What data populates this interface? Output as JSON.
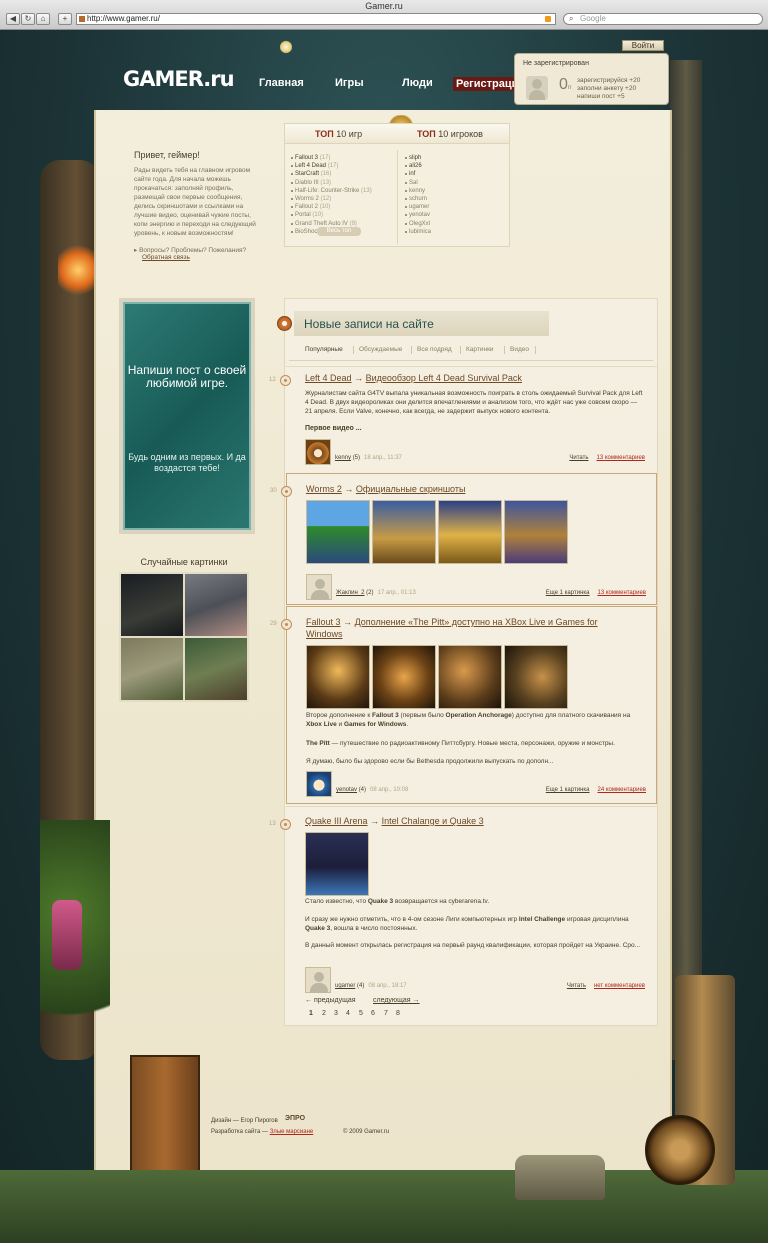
{
  "browser": {
    "window_title": "Gamer.ru",
    "url": "http://www.gamer.ru/",
    "search_placeholder": "Google"
  },
  "header": {
    "logo": "GAMER.ru",
    "nav": [
      "Главная",
      "Игры",
      "Люди",
      "Регистрация"
    ]
  },
  "login": {
    "button": "Войти",
    "status": "Не зарегистрирован",
    "points": "0",
    "points_unit": "п",
    "hints": [
      "зарегистрируйся +20",
      "заполни анкету +20",
      "напиши пост +5"
    ]
  },
  "greeting": {
    "title": "Привет, геймер!",
    "text": "Рады видеть тебя на главном игровом сайте года. Для начала можешь прокачаться: заполняй профиль, размещай свои первые сообщения, делись скриншотами и ссылками на лучшие видео, оценивай чужие посты, копи энергию и переходи на следующий уровень, к новым возможностям!",
    "questions": "Вопросы? Проблемы? Пожелания?",
    "feedback": "Обратная связь"
  },
  "top10": {
    "games_label_prefix": "ТОП",
    "games_label_num": "10",
    "games_label": "игр",
    "players_label": "игроков",
    "games": [
      {
        "name": "Fallout 3",
        "count": "(17)",
        "dim": false
      },
      {
        "name": "Left 4 Dead",
        "count": "(17)",
        "dim": false
      },
      {
        "name": "StarCraft",
        "count": "(16)",
        "dim": false
      },
      {
        "name": "Diablo III",
        "count": "(13)",
        "dim": true
      },
      {
        "name": "Half-Life: Counter-Strike",
        "count": "(13)",
        "dim": true
      },
      {
        "name": "Worms 2",
        "count": "(12)",
        "dim": true
      },
      {
        "name": "Fallout 2",
        "count": "(10)",
        "dim": true
      },
      {
        "name": "Portal",
        "count": "(10)",
        "dim": true
      },
      {
        "name": "Grand Theft Auto IV",
        "count": "(9)",
        "dim": true
      },
      {
        "name": "BioShock",
        "count": "(7)",
        "dim": true
      }
    ],
    "players": [
      "sliph",
      "ali26",
      "inf",
      "Sal",
      "kenny",
      "schurn",
      "ugamer",
      "yenotav",
      "OlegXxl",
      "lubimica"
    ],
    "all_button": "Весь топ"
  },
  "promo": {
    "line1": "Напиши пост о своей любимой игре.",
    "line2": "Будь одним из первых. И да воздастся тебе!"
  },
  "random": {
    "title": "Случайные картинки"
  },
  "feed": {
    "title": "Новые записи на сайте",
    "tabs": [
      "Популярные",
      "Обсуждаемые",
      "Все подряд",
      "Картинки",
      "Видео"
    ],
    "posts": [
      {
        "index": "12",
        "game": "Left 4 Dead",
        "arrow": "→",
        "title": "Видеообзор Left 4 Dead Survival Pack",
        "text": "Журналистам сайта G4TV выпала уникальная возможность поиграть в столь ожидаемый Survival Pack для Left 4 Dead. В двух видеороликах они делится впечатлениями и анализом того, что ждёт нас уже совсем скоро — 21 апреля. Если Valve, конечно, как всегда, не задержит выпуск нового контента.",
        "more": "Первое видео ...",
        "user": "kenny",
        "level": "(5)",
        "date": "18 апр., 11:37",
        "read": "Читать",
        "comments": "13 комментариев"
      },
      {
        "index": "30",
        "game": "Worms 2",
        "arrow": "→",
        "title": "Официальные скриншоты",
        "user": "Жаклин_2",
        "level": "(2)",
        "date": "17 апр., 01:13",
        "read": "Еще 1 картинка",
        "comments": "13 комментариев"
      },
      {
        "index": "29",
        "game": "Fallout 3",
        "arrow": "→",
        "title": "Дополнение «The Pitt» доступно на XBox Live и Games for Windows",
        "text1_pre": "Второе дополнение к ",
        "text1_b1": "Fallout 3",
        "text1_mid": " (первым было ",
        "text1_b2": "Operation Anchorage",
        "text1_mid2": ") доступно для платного скачивания на ",
        "text1_b3": "Xbox Live",
        "text1_and": " и ",
        "text1_b4": "Games for Windows",
        "text1_end": ".",
        "text2_b": "The Pitt",
        "text2": " — путешествие по радиоактивному Питтсбургу. Новые места, персонажи, оружие и монстры.",
        "text3": "Я думаю, было бы здорово если бы Bethesda продолжили выпускать по дополн...",
        "user": "yenotav",
        "level": "(4)",
        "date": "08 апр., 10:08",
        "read": "Еще 1 картинка",
        "comments": "24 комментариев"
      },
      {
        "index": "13",
        "game": "Quake III Arena",
        "arrow": "→",
        "title": "Intel Chalange и Quake 3",
        "text1_pre": "Стало известно, что ",
        "text1_b": "Quake 3",
        "text1_end": " возвращается на cyberarena.tv.",
        "text2_pre": "И сразу же нужно отметить, что в 4-ом сезоне Лиги компьютерных игр ",
        "text2_b1": "Intel Challenge",
        "text2_mid": " игровая дисциплина ",
        "text2_b2": "Quake 3",
        "text2_end": ", вошла в число постоянных.",
        "text3": "В данный момент открылась регистрация на первый раунд квалификации, которая пройдет на Украине. Сро...",
        "user": "ugamer",
        "level": "(4)",
        "date": "08 апр., 18:17",
        "read": "Читать",
        "comments": "нет комментариев"
      }
    ]
  },
  "pager": {
    "prev": "← предыдущая",
    "next": "следующая →",
    "pages": [
      "1",
      "2",
      "3",
      "4",
      "5",
      "6",
      "7",
      "8"
    ]
  },
  "footer": {
    "design": "Дизайн — Егор Пирогов",
    "design_mark": "ЭПРО",
    "dev": "Разработка сайта — ",
    "dev_link": "Злые марсиане",
    "copyright": "© 2009 Gamer.ru"
  }
}
